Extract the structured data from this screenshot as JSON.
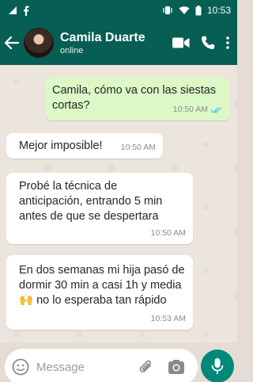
{
  "status_bar": {
    "time": "10:53"
  },
  "header": {
    "contact_name": "Camila Duarte",
    "contact_status": "online"
  },
  "messages": [
    {
      "direction": "outgoing",
      "text": "Camila, cómo va con las siestas\ncortas?",
      "time": "10:50 AM",
      "read": true
    },
    {
      "direction": "incoming",
      "text": "Mejor imposible!",
      "time": "10:50 AM"
    },
    {
      "direction": "incoming",
      "text": "Probé la técnica de\nanticipación, entrando 5 min\nantes de que se despertara",
      "time": "10:50 AM"
    },
    {
      "direction": "incoming",
      "text": "En dos semanas mi hija pasó de\ndormir 30 min a casi 1h y media\n🙌 no lo esperaba tan rápido",
      "time": "10:53 AM"
    }
  ],
  "composer": {
    "placeholder": "Message"
  },
  "colors": {
    "header": "#075e54",
    "outgoing_bubble": "#dcf8c6",
    "incoming_bubble": "#ffffff",
    "mic_button": "#00897b",
    "read_ticks": "#4fc3f7"
  }
}
